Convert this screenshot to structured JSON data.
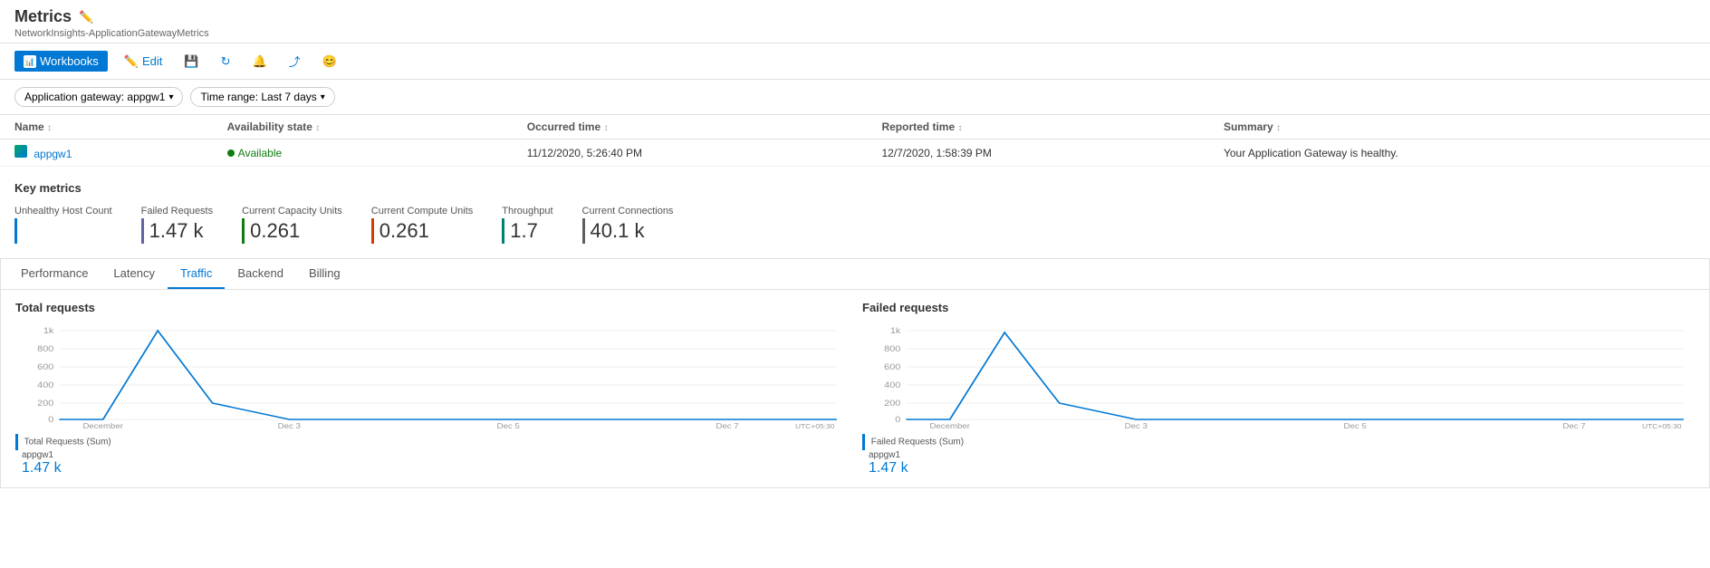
{
  "page": {
    "title": "Metrics",
    "breadcrumb": "NetworkInsights-ApplicationGatewayMetrics"
  },
  "toolbar": {
    "workbooks_label": "Workbooks",
    "edit_label": "Edit",
    "save_icon": "💾",
    "refresh_icon": "↻",
    "bell_icon": "🔔",
    "share_icon": "⤴",
    "feedback_icon": "😊"
  },
  "filters": {
    "gateway_label": "Application gateway: appgw1",
    "timerange_label": "Time range: Last 7 days"
  },
  "health_table": {
    "columns": [
      {
        "label": "Name",
        "sortable": true
      },
      {
        "label": "Availability state",
        "sortable": true
      },
      {
        "label": "Occurred time",
        "sortable": true
      },
      {
        "label": "Reported time",
        "sortable": true
      },
      {
        "label": "Summary",
        "sortable": true
      }
    ],
    "rows": [
      {
        "name": "appgw1",
        "availability": "Available",
        "occurred": "11/12/2020, 5:26:40 PM",
        "reported": "12/7/2020, 1:58:39 PM",
        "summary": "Your Application Gateway is healthy."
      }
    ]
  },
  "key_metrics": {
    "title": "Key metrics",
    "items": [
      {
        "label": "Unhealthy Host Count",
        "value": "",
        "bar_class": "bar-blue"
      },
      {
        "label": "Failed Requests",
        "value": "1.47 k",
        "bar_class": "bar-purple"
      },
      {
        "label": "Current Capacity Units",
        "value": "0.261",
        "bar_class": "bar-green"
      },
      {
        "label": "Current Compute Units",
        "value": "0.261",
        "bar_class": "bar-orange"
      },
      {
        "label": "Throughput",
        "value": "1.7",
        "bar_class": "bar-teal"
      },
      {
        "label": "Current Connections",
        "value": "40.1 k",
        "bar_class": "bar-gray"
      }
    ]
  },
  "tabs": {
    "items": [
      "Performance",
      "Latency",
      "Traffic",
      "Backend",
      "Billing"
    ],
    "active": "Traffic"
  },
  "charts": {
    "total_requests": {
      "title": "Total requests",
      "legend_label": "Total Requests (Sum)",
      "legend_sub": "appgw1",
      "legend_value": "1.47 k",
      "utc": "UTC+05:30",
      "x_labels": [
        "December",
        "Dec 3",
        "Dec 5",
        "Dec 7"
      ],
      "y_labels": [
        "1k",
        "800",
        "600",
        "400",
        "200",
        "0"
      ]
    },
    "failed_requests": {
      "title": "Failed requests",
      "legend_label": "Failed Requests (Sum)",
      "legend_sub": "appgw1",
      "legend_value": "1.47 k",
      "utc": "UTC+05:30",
      "x_labels": [
        "December",
        "Dec 3",
        "Dec 5",
        "Dec 7"
      ],
      "y_labels": [
        "1k",
        "800",
        "600",
        "400",
        "200",
        "0"
      ]
    }
  }
}
